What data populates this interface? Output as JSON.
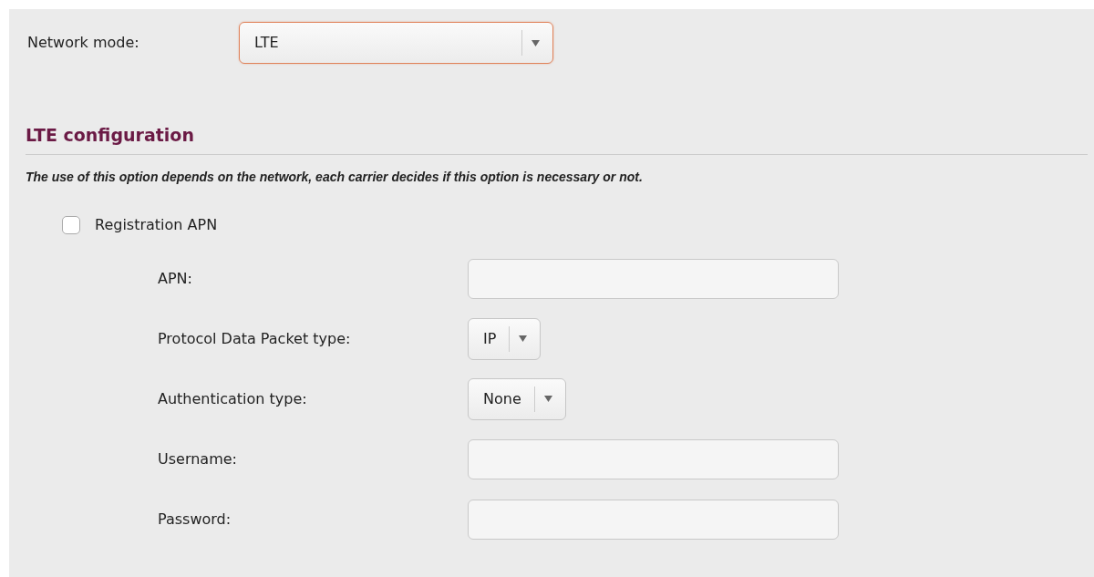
{
  "network_mode": {
    "label": "Network mode:",
    "value": "LTE",
    "focused": true
  },
  "section": {
    "title": "LTE configuration",
    "note": "The use of this option depends on the network, each carrier decides if this option is necessary or not."
  },
  "registration_apn": {
    "label": "Registration APN",
    "checked": false
  },
  "fields": [
    {
      "kind": "text",
      "label": "APN:"
    },
    {
      "kind": "select",
      "label": "Protocol Data Packet type:",
      "value": "IP"
    },
    {
      "kind": "select",
      "label": "Authentication type:",
      "value": "None"
    },
    {
      "kind": "text",
      "label": "Username:"
    },
    {
      "kind": "text",
      "label": "Password:"
    }
  ]
}
